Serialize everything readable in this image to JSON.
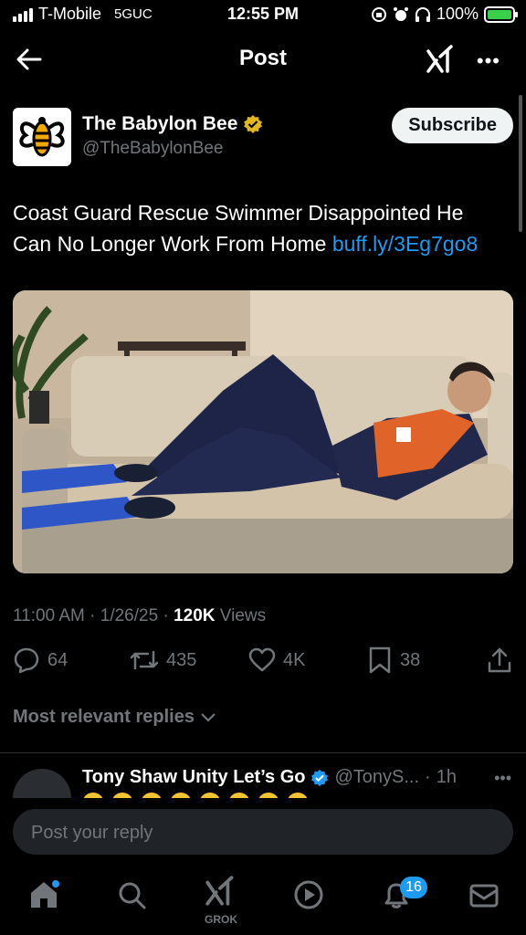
{
  "status_bar": {
    "carrier": "T-Mobile",
    "network": "5GUC",
    "time": "12:55 PM",
    "battery": "100%"
  },
  "header": {
    "title": "Post"
  },
  "post": {
    "author_name": "The Babylon Bee",
    "author_handle": "@TheBabylonBee",
    "subscribe_label": "Subscribe",
    "text": "Coast Guard Rescue Swimmer Disappointed He Can No Longer Work From Home",
    "link": "buff.ly/3Eg7go8",
    "time": "11:00 AM",
    "date": "1/26/25",
    "views_count": "120K",
    "views_label": "Views"
  },
  "actions": {
    "replies": "64",
    "reposts": "435",
    "likes": "4K",
    "bookmarks": "38"
  },
  "replies_section": {
    "label": "Most relevant replies"
  },
  "reply": {
    "name": "Tony Shaw Unity Let’s Go",
    "handle": "@TonyS...",
    "time": "1h"
  },
  "reply_box": {
    "placeholder": "Post your reply"
  },
  "tabbar": {
    "grok_label": "GROK",
    "notifications_count": "16"
  },
  "colors": {
    "accent": "#1d9bf0",
    "verified_gold": "#e2b719",
    "muted": "#71767b"
  }
}
